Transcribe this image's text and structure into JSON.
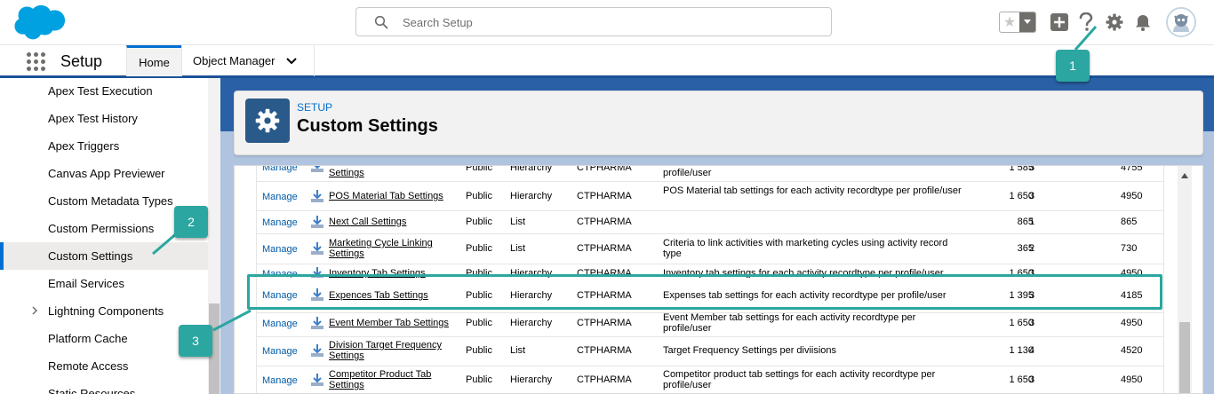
{
  "header": {
    "search_placeholder": "Search Setup",
    "icons": [
      "favorites-star-icon",
      "add-icon",
      "help-icon",
      "setup-gear-icon",
      "notifications-bell-icon",
      "avatar"
    ]
  },
  "context": {
    "app_name": "Setup",
    "tabs": [
      {
        "label": "Home",
        "active": true
      },
      {
        "label": "Object Manager",
        "active": false
      }
    ]
  },
  "sidebar": {
    "items": [
      {
        "label": "Apex Test Execution"
      },
      {
        "label": "Apex Test History"
      },
      {
        "label": "Apex Triggers"
      },
      {
        "label": "Canvas App Previewer"
      },
      {
        "label": "Custom Metadata Types"
      },
      {
        "label": "Custom Permissions"
      },
      {
        "label": "Custom Settings",
        "active": true
      },
      {
        "label": "Email Services"
      },
      {
        "label": "Lightning Components",
        "expandable": true
      },
      {
        "label": "Platform Cache"
      },
      {
        "label": "Remote Access"
      },
      {
        "label": "Static Resources"
      }
    ]
  },
  "page": {
    "eyebrow": "SETUP",
    "title": "Custom Settings"
  },
  "table": {
    "action_label": "Manage",
    "rows": [
      {
        "label": "Settings",
        "visibility": "Public",
        "type": "Hierarchy",
        "namespace": "CTPHARMA",
        "description": "profile/user",
        "size": "1 585",
        "records": "3",
        "total": "4755"
      },
      {
        "label": "POS Material Tab Settings",
        "visibility": "Public",
        "type": "Hierarchy",
        "namespace": "CTPHARMA",
        "description": "POS Material tab settings for each activity recordtype per profile/user",
        "size": "1 650",
        "records": "3",
        "total": "4950"
      },
      {
        "label": "Next Call Settings",
        "visibility": "Public",
        "type": "List",
        "namespace": "CTPHARMA",
        "description": "",
        "size": "865",
        "records": "1",
        "total": "865"
      },
      {
        "label": "Marketing Cycle Linking Settings",
        "visibility": "Public",
        "type": "List",
        "namespace": "CTPHARMA",
        "description": "Criteria to link activities with marketing cycles using activity record type",
        "size": "365",
        "records": "2",
        "total": "730"
      },
      {
        "label": "Inventory Tab Settings",
        "visibility": "Public",
        "type": "Hierarchy",
        "namespace": "CTPHARMA",
        "description": "Inventory tab settings for each activity recordtype per profile/user",
        "size": "1 650",
        "records": "3",
        "total": "4950"
      },
      {
        "label": "Expences Tab Settings",
        "visibility": "Public",
        "type": "Hierarchy",
        "namespace": "CTPHARMA",
        "description": "Expenses tab settings for each activity recordtype per profile/user",
        "size": "1 395",
        "records": "3",
        "total": "4185"
      },
      {
        "label": "Event Member Tab Settings",
        "visibility": "Public",
        "type": "Hierarchy",
        "namespace": "CTPHARMA",
        "description": "Event Member tab settings for each activity recordtype per profile/user",
        "size": "1 650",
        "records": "3",
        "total": "4950"
      },
      {
        "label": "Division Target Frequency Settings",
        "visibility": "Public",
        "type": "List",
        "namespace": "CTPHARMA",
        "description": "Target Frequency Settings per diviisions",
        "size": "1 130",
        "records": "4",
        "total": "4520"
      },
      {
        "label": "Competitor Product Tab Settings",
        "visibility": "Public",
        "type": "Hierarchy",
        "namespace": "CTPHARMA",
        "description": "Competitor product tab settings for each activity recordtype per profile/user",
        "size": "1 650",
        "records": "3",
        "total": "4950"
      }
    ]
  },
  "callouts": [
    "1",
    "2",
    "3"
  ],
  "colors": {
    "brand_blue": "#0070d2",
    "salesforce_cloud": "#00a1e0",
    "callout_teal": "#2ba6a0",
    "link_blue": "#015ba7"
  }
}
